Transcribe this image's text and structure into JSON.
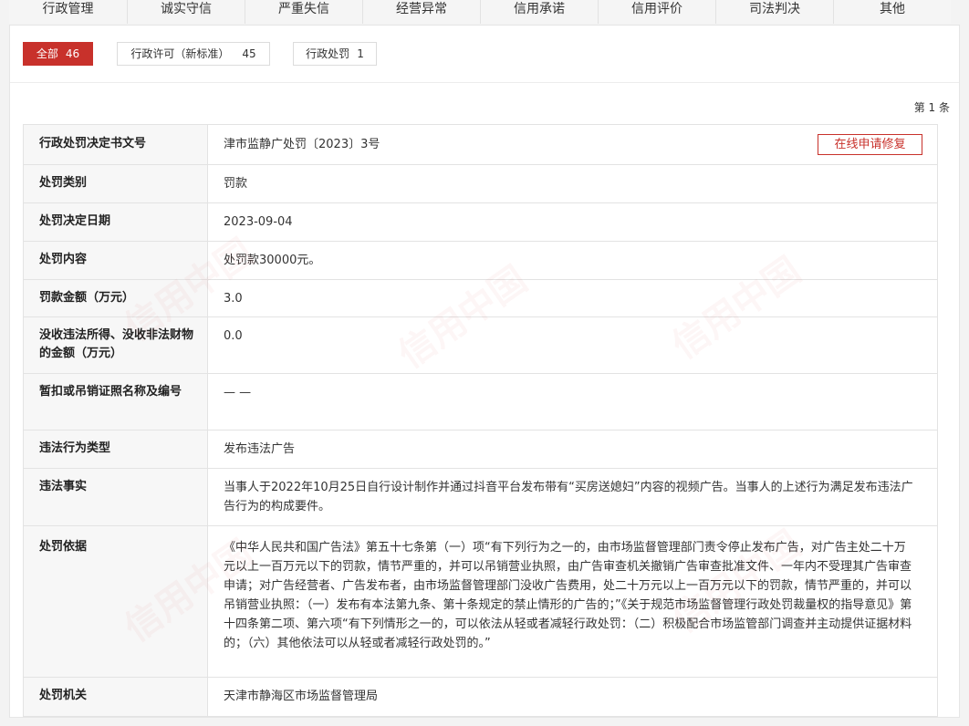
{
  "tabs": [
    {
      "label": "行政管理",
      "active": true
    },
    {
      "label": "诚实守信",
      "active": false
    },
    {
      "label": "严重失信",
      "active": false
    },
    {
      "label": "经营异常",
      "active": false
    },
    {
      "label": "信用承诺",
      "active": false
    },
    {
      "label": "信用评价",
      "active": false
    },
    {
      "label": "司法判决",
      "active": false
    },
    {
      "label": "其他",
      "active": false
    }
  ],
  "filters": [
    {
      "label": "全部",
      "count": "46",
      "active": true
    },
    {
      "label": "行政许可（新标准）",
      "count": "45",
      "active": false
    },
    {
      "label": "行政处罚",
      "count": "1",
      "active": false
    }
  ],
  "pager": {
    "text": "第 1 条"
  },
  "repair_button": {
    "label": "在线申请修复"
  },
  "watermark": {
    "text": "信用中国"
  },
  "record": [
    {
      "label": "行政处罚决定书文号",
      "value": "津市监静广处罚〔2023〕3号"
    },
    {
      "label": "处罚类别",
      "value": "罚款"
    },
    {
      "label": "处罚决定日期",
      "value": "2023-09-04"
    },
    {
      "label": "处罚内容",
      "value": "处罚款30000元。"
    },
    {
      "label": "罚款金额（万元）",
      "value": "3.0"
    },
    {
      "label": "没收违法所得、没收非法财物的金额（万元）",
      "value": "0.0"
    },
    {
      "label": "暂扣或吊销证照名称及编号",
      "value": "— —"
    },
    {
      "label": "违法行为类型",
      "value": "发布违法广告"
    },
    {
      "label": "违法事实",
      "value": "当事人于2022年10月25日自行设计制作并通过抖音平台发布带有“买房送媳妇”内容的视频广告。当事人的上述行为满足发布违法广告行为的构成要件。"
    },
    {
      "label": "处罚依据",
      "value": "《中华人民共和国广告法》第五十七条第（一）项“有下列行为之一的，由市场监督管理部门责令停止发布广告，对广告主处二十万元以上一百万元以下的罚款，情节严重的，并可以吊销营业执照，由广告审查机关撤销广告审查批准文件、一年内不受理其广告审查申请；对广告经营者、广告发布者，由市场监督管理部门没收广告费用，处二十万元以上一百万元以下的罚款，情节严重的，并可以吊销营业执照：（一）发布有本法第九条、第十条规定的禁止情形的广告的；”《关于规范市场监督管理行政处罚裁量权的指导意见》第十四条第二项、第六项“有下列情形之一的，可以依法从轻或者减轻行政处罚：（二）积极配合市场监管部门调查并主动提供证据材料的；（六）其他依法可以从轻或者减轻行政处罚的。”"
    },
    {
      "label": "处罚机关",
      "value": "天津市静海区市场监督管理局"
    }
  ]
}
